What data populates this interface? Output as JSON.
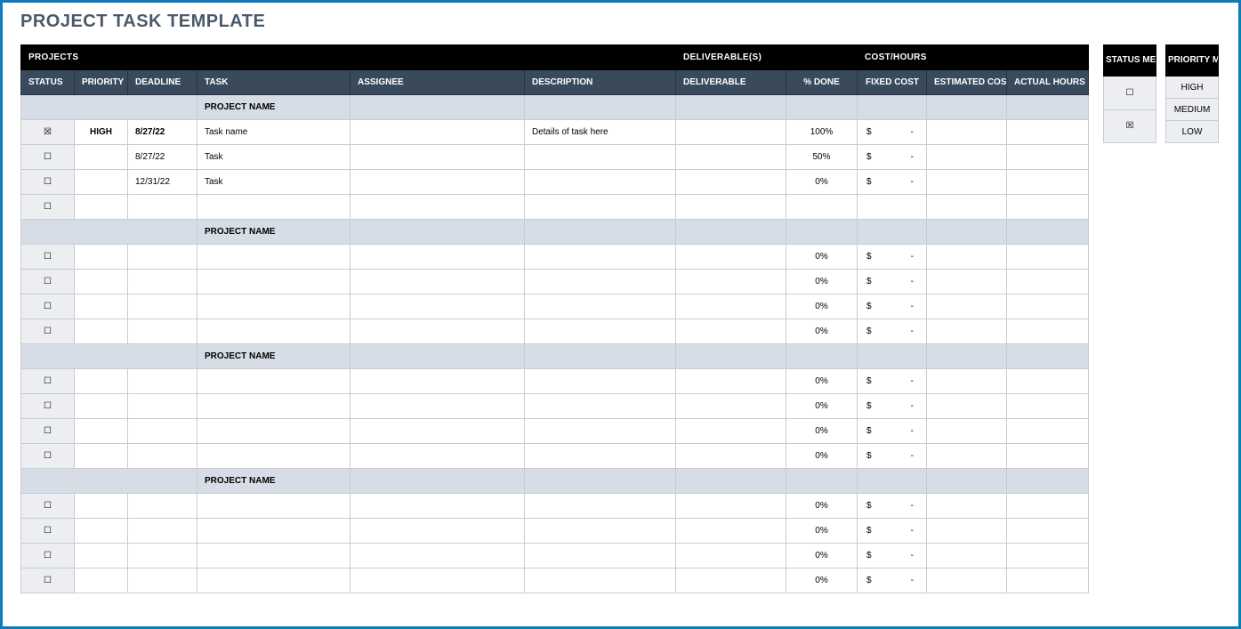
{
  "title": "PROJECT TASK TEMPLATE",
  "topHeaders": {
    "projects": "PROJECTS",
    "deliverables": "DELIVERABLE(S)",
    "costHours": "COST/HOURS"
  },
  "cols": {
    "status": "STATUS",
    "priority": "PRIORITY",
    "deadline": "DEADLINE",
    "task": "TASK",
    "assignee": "ASSIGNEE",
    "description": "DESCRIPTION",
    "deliverable": "DELIVERABLE",
    "done": "% DONE",
    "fixed": "FIXED COST",
    "est": "ESTIMATED COST",
    "actual": "ACTUAL HOURS"
  },
  "groupLabel": "PROJECT NAME",
  "groups": [
    {
      "rows": [
        {
          "checked": true,
          "priority": "HIGH",
          "deadline": "8/27/22",
          "task": "Task name",
          "description": "Details of task here",
          "done": "100%",
          "cost": "$   -"
        },
        {
          "checked": false,
          "priority": "",
          "deadline": "8/27/22",
          "task": "Task",
          "description": "",
          "done": "50%",
          "cost": "$   -"
        },
        {
          "checked": false,
          "priority": "",
          "deadline": "12/31/22",
          "task": "Task",
          "description": "",
          "done": "0%",
          "cost": "$   -"
        },
        {
          "checked": false,
          "priority": "",
          "deadline": "",
          "task": "",
          "description": "",
          "done": "",
          "cost": ""
        }
      ]
    },
    {
      "rows": [
        {
          "checked": false,
          "priority": "",
          "deadline": "",
          "task": "",
          "description": "",
          "done": "0%",
          "cost": "$   -"
        },
        {
          "checked": false,
          "priority": "",
          "deadline": "",
          "task": "",
          "description": "",
          "done": "0%",
          "cost": "$   -"
        },
        {
          "checked": false,
          "priority": "",
          "deadline": "",
          "task": "",
          "description": "",
          "done": "0%",
          "cost": "$   -"
        },
        {
          "checked": false,
          "priority": "",
          "deadline": "",
          "task": "",
          "description": "",
          "done": "0%",
          "cost": "$   -"
        }
      ]
    },
    {
      "rows": [
        {
          "checked": false,
          "priority": "",
          "deadline": "",
          "task": "",
          "description": "",
          "done": "0%",
          "cost": "$   -"
        },
        {
          "checked": false,
          "priority": "",
          "deadline": "",
          "task": "",
          "description": "",
          "done": "0%",
          "cost": "$   -"
        },
        {
          "checked": false,
          "priority": "",
          "deadline": "",
          "task": "",
          "description": "",
          "done": "0%",
          "cost": "$   -"
        },
        {
          "checked": false,
          "priority": "",
          "deadline": "",
          "task": "",
          "description": "",
          "done": "0%",
          "cost": "$   -"
        }
      ]
    },
    {
      "rows": [
        {
          "checked": false,
          "priority": "",
          "deadline": "",
          "task": "",
          "description": "",
          "done": "0%",
          "cost": "$   -"
        },
        {
          "checked": false,
          "priority": "",
          "deadline": "",
          "task": "",
          "description": "",
          "done": "0%",
          "cost": "$   -"
        },
        {
          "checked": false,
          "priority": "",
          "deadline": "",
          "task": "",
          "description": "",
          "done": "0%",
          "cost": "$   -"
        },
        {
          "checked": false,
          "priority": "",
          "deadline": "",
          "task": "",
          "description": "",
          "done": "0%",
          "cost": "$   -"
        }
      ]
    }
  ],
  "statusMenu": {
    "title": "STATUS MENU",
    "items": [
      {
        "checked": false
      },
      {
        "checked": true
      }
    ]
  },
  "priorityMenu": {
    "title": "PRIORITY MENU",
    "items": [
      "HIGH",
      "MEDIUM",
      "LOW"
    ]
  },
  "glyphs": {
    "unchecked": "☐",
    "checked": "☒"
  }
}
